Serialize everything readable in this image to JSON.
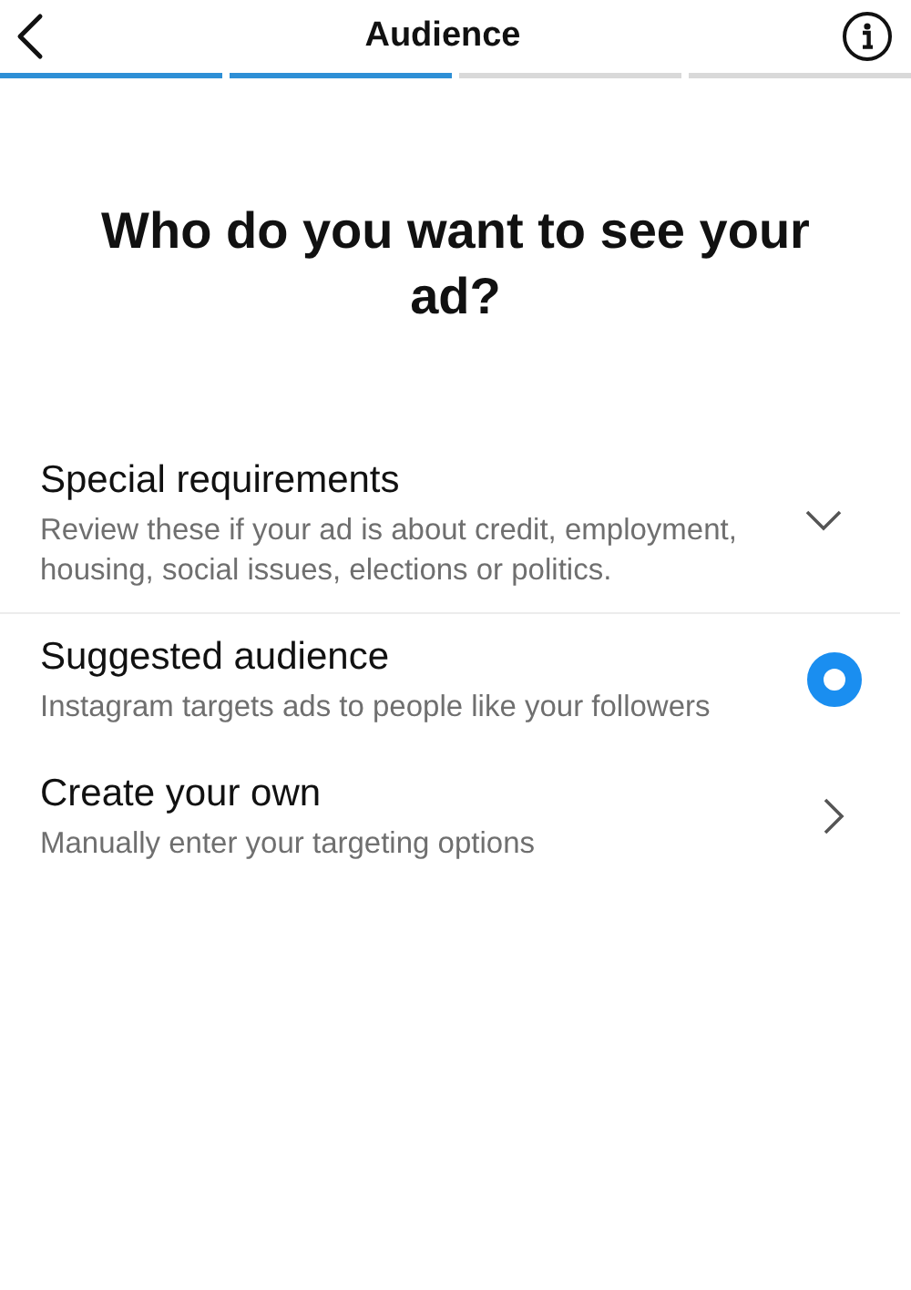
{
  "header": {
    "title": "Audience"
  },
  "progress": [
    {
      "completed": true
    },
    {
      "completed": true
    },
    {
      "completed": false
    },
    {
      "completed": false
    }
  ],
  "heading": "Who do you want to see your ad?",
  "options": [
    {
      "kind": "dropdown",
      "title": "Special requirements",
      "description": "Review these if your ad is about credit, employment, housing, social issues, elections or politics.",
      "expanded": false
    },
    {
      "kind": "radio",
      "title": "Suggested audience",
      "description": "Instagram targets ads to people like your followers",
      "selected": true
    },
    {
      "kind": "link",
      "title": "Create your own",
      "description": "Manually enter your targeting options"
    }
  ]
}
